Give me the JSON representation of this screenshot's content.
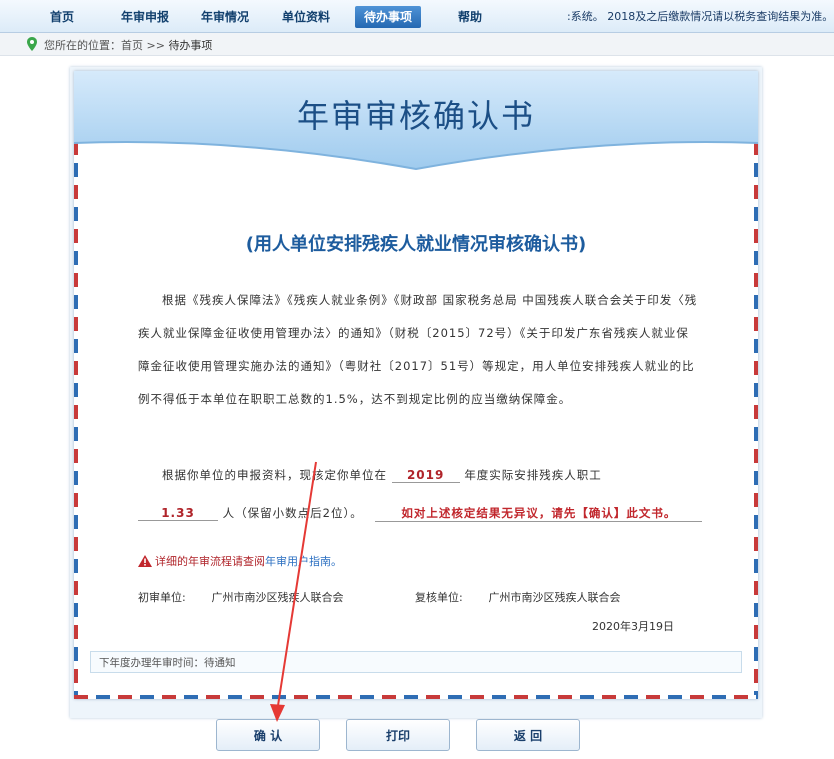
{
  "nav": {
    "items": [
      {
        "label": "首页"
      },
      {
        "label": "年审申报"
      },
      {
        "label": "年审情况"
      },
      {
        "label": "单位资料"
      },
      {
        "label": "待办事项"
      },
      {
        "label": "帮助"
      }
    ],
    "active": "待办事项",
    "notice": ":系统。      2018及之后缴款情况请以税务查询结果为准。"
  },
  "breadcrumb": {
    "prefix": "您所在的位置：首页 >> ",
    "current": "待办事项"
  },
  "certificate": {
    "title": "年审审核确认书",
    "subtitle": "(用人单位安排残疾人就业情况审核确认书)",
    "body": "根据《残疾人保障法》《残疾人就业条例》《财政部 国家税务总局 中国残疾人联合会关于印发〈残疾人就业保障金征收使用管理办法〉的通知》（财税〔2015〕72号）《关于印发广东省残疾人就业保障金征收使用管理实施办法的通知》（粤财社〔2017〕51号）等规定，用人单位安排残疾人就业的比例不得低于本单位在职职工总数的1.5%，达不到规定比例的应当缴纳保障金。",
    "line2_prefix": "根据你单位的申报资料，现核定你单位在",
    "year": "2019",
    "line2_suffix": "年度实际安排残疾人职工",
    "count": "1.33",
    "count_suffix": "人（保留小数点后2位）。",
    "confirm_note": "如对上述核定结果无异议，请先【确认】此文书。",
    "guide_prefix": "详细的年审流程请查阅",
    "guide_link": "年审用户指南。",
    "first_unit_label": "初审单位:",
    "first_unit": "广州市南沙区残疾人联合会",
    "review_unit_label": "复核单位:",
    "review_unit": "广州市南沙区残疾人联合会",
    "date": "2020年3月19日",
    "next_year": "下年度办理年审时间：待通知"
  },
  "buttons": {
    "confirm": "确 认",
    "print": "打印",
    "back": "返 回"
  },
  "colors": {
    "accent": "#2468b2",
    "warning": "#c1272d",
    "annotation_arrow": "#e53935"
  }
}
